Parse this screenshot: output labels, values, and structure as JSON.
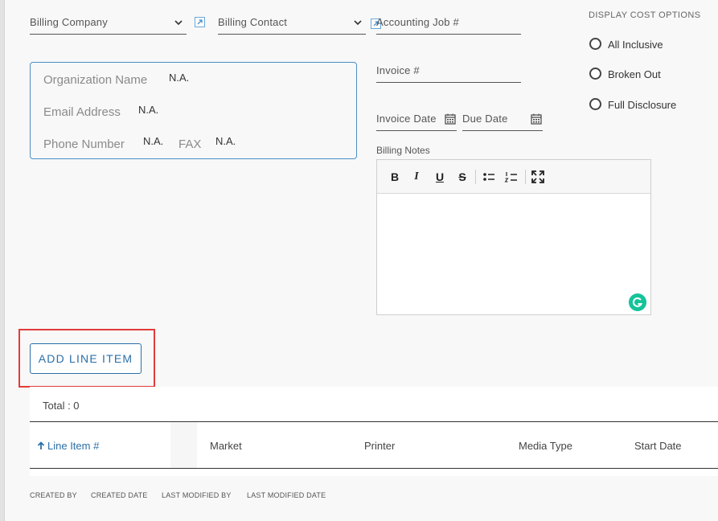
{
  "billing_company": {
    "label": "Billing Company"
  },
  "billing_contact": {
    "label": "Billing Contact"
  },
  "accounting_job": {
    "label": "Accounting Job #"
  },
  "invoice_number": {
    "label": "Invoice #"
  },
  "invoice_date": {
    "label": "Invoice Date"
  },
  "due_date": {
    "label": "Due Date"
  },
  "organization": {
    "name_label": "Organization Name",
    "name_value": "N.A.",
    "email_label": "Email Address",
    "email_value": "N.A.",
    "phone_label": "Phone Number",
    "phone_value": "N.A.",
    "fax_label": "FAX",
    "fax_value": "N.A."
  },
  "cost_options": {
    "title": "DISPLAY COST OPTIONS",
    "options": [
      "All Inclusive",
      "Broken Out",
      "Full Disclosure"
    ]
  },
  "billing_notes": {
    "label": "Billing Notes",
    "toolbar": {
      "bold": "B",
      "italic": "I",
      "underline": "U",
      "strike": "S"
    }
  },
  "add_line_item": {
    "label": "ADD LINE ITEM"
  },
  "table": {
    "total": "Total : 0",
    "columns": [
      "Line Item #",
      "Market",
      "Printer",
      "Media Type",
      "Start Date"
    ]
  },
  "meta": {
    "created_by": "CREATED BY",
    "created_date": "CREATED DATE",
    "last_modified_by": "LAST MODIFIED BY",
    "last_modified_date": "LAST MODIFIED DATE"
  },
  "colors": {
    "accent": "#2a6fa8",
    "highlight": "#e23b3b",
    "grammarly": "#15c39a"
  }
}
